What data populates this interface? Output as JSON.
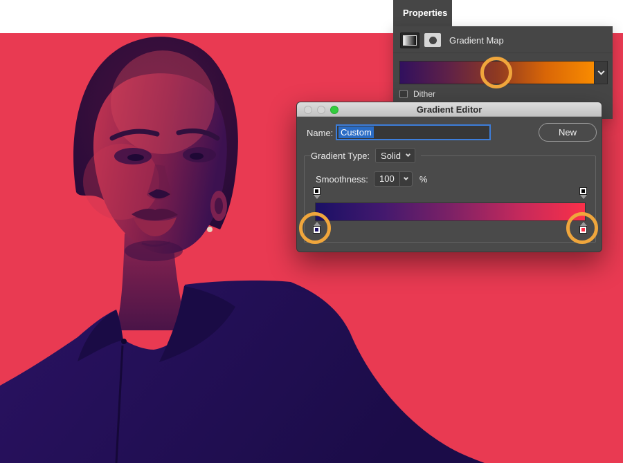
{
  "canvas": {
    "background_color": "#e93a52",
    "duotone": {
      "hair_color": "#331040",
      "skin_highlight": "#c43552",
      "skin_shadow": "#3c1150",
      "shirt_color": "#231057"
    }
  },
  "properties_panel": {
    "tab_label": "Properties",
    "adjustment_title": "Gradient Map",
    "gradient_preview_stops": [
      "#31105e",
      "#5f2148",
      "#8f3a21",
      "#d96607",
      "#f98b00"
    ],
    "dither_label": "Dither"
  },
  "gradient_editor": {
    "window_title": "Gradient Editor",
    "traffic_lights": {
      "close": "#d4d4d4",
      "minimize": "#d4d4d4",
      "zoom": "#32cd3e"
    },
    "name_label": "Name:",
    "name_value": "Custom",
    "new_button_label": "New",
    "gradient_type_label": "Gradient Type:",
    "gradient_type_value": "Solid",
    "smoothness_label": "Smoothness:",
    "smoothness_value": "100",
    "smoothness_unit": "%",
    "gradient_bar_stops": [
      "#1a1065",
      "#43196e",
      "#7c2166",
      "#c2295c",
      "#fb3049"
    ],
    "stops": {
      "opacity_left": "#000000",
      "opacity_right": "#000000",
      "color_left": "#1c1166",
      "color_right": "#fb2d45"
    }
  },
  "annotations": {
    "circle_color": "#f0a63c"
  }
}
